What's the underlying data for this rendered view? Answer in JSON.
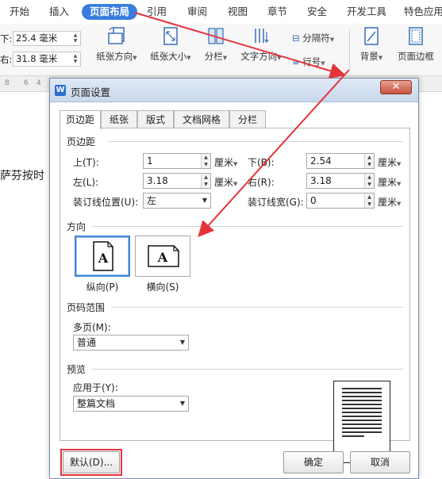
{
  "colors": {
    "accent": "#3a7de0",
    "highlight_red": "#e5333a",
    "close_red": "#c8513d"
  },
  "ribbon": {
    "tabs": [
      "开始",
      "插入",
      "页面布局",
      "引用",
      "审阅",
      "视图",
      "章节",
      "安全",
      "开发工具",
      "特色应用"
    ],
    "active_tab": "页面布局"
  },
  "toolbar": {
    "top_margin_label": "下:",
    "top_margin_value": "25.4 毫米",
    "left_margin_label": "右:",
    "left_margin_value": "31.8 毫米",
    "paper_orientation": "纸张方向",
    "paper_size": "纸张大小",
    "columns": "分栏",
    "text_direction": "文字方向",
    "separator": "分隔符",
    "line_number": "行号",
    "background": "背景",
    "page_border": "页面边框"
  },
  "ruler": {
    "ticks": [
      "8",
      "6",
      "4"
    ]
  },
  "document": {
    "visible_text": "萨芬按时"
  },
  "dialog": {
    "title": "页面设置",
    "close_symbol": "✕",
    "tabs": [
      "页边距",
      "纸张",
      "版式",
      "文档网格",
      "分栏"
    ],
    "active_tab": "页边距",
    "margins_section": "页边距",
    "top_label": "上(T):",
    "top_value": "1",
    "bottom_label": "下(B):",
    "bottom_value": "2.54",
    "left_label": "左(L):",
    "left_value": "3.18",
    "right_label": "右(R):",
    "right_value": "3.18",
    "gutter_pos_label": "装订线位置(U):",
    "gutter_pos_value": "左",
    "gutter_width_label": "装订线宽(G):",
    "gutter_width_value": "0",
    "unit": "厘米",
    "orientation_section": "方向",
    "portrait": "纵向(P)",
    "landscape": "横向(S)",
    "orientation_glyph": "A",
    "pages_section": "页码范围",
    "multiple_pages_label": "多页(M):",
    "multiple_pages_value": "普通",
    "preview_section": "预览",
    "apply_to_label": "应用于(Y):",
    "apply_to_value": "整篇文档",
    "default_button": "默认(D)...",
    "ok_button": "确定",
    "cancel_button": "取消"
  }
}
